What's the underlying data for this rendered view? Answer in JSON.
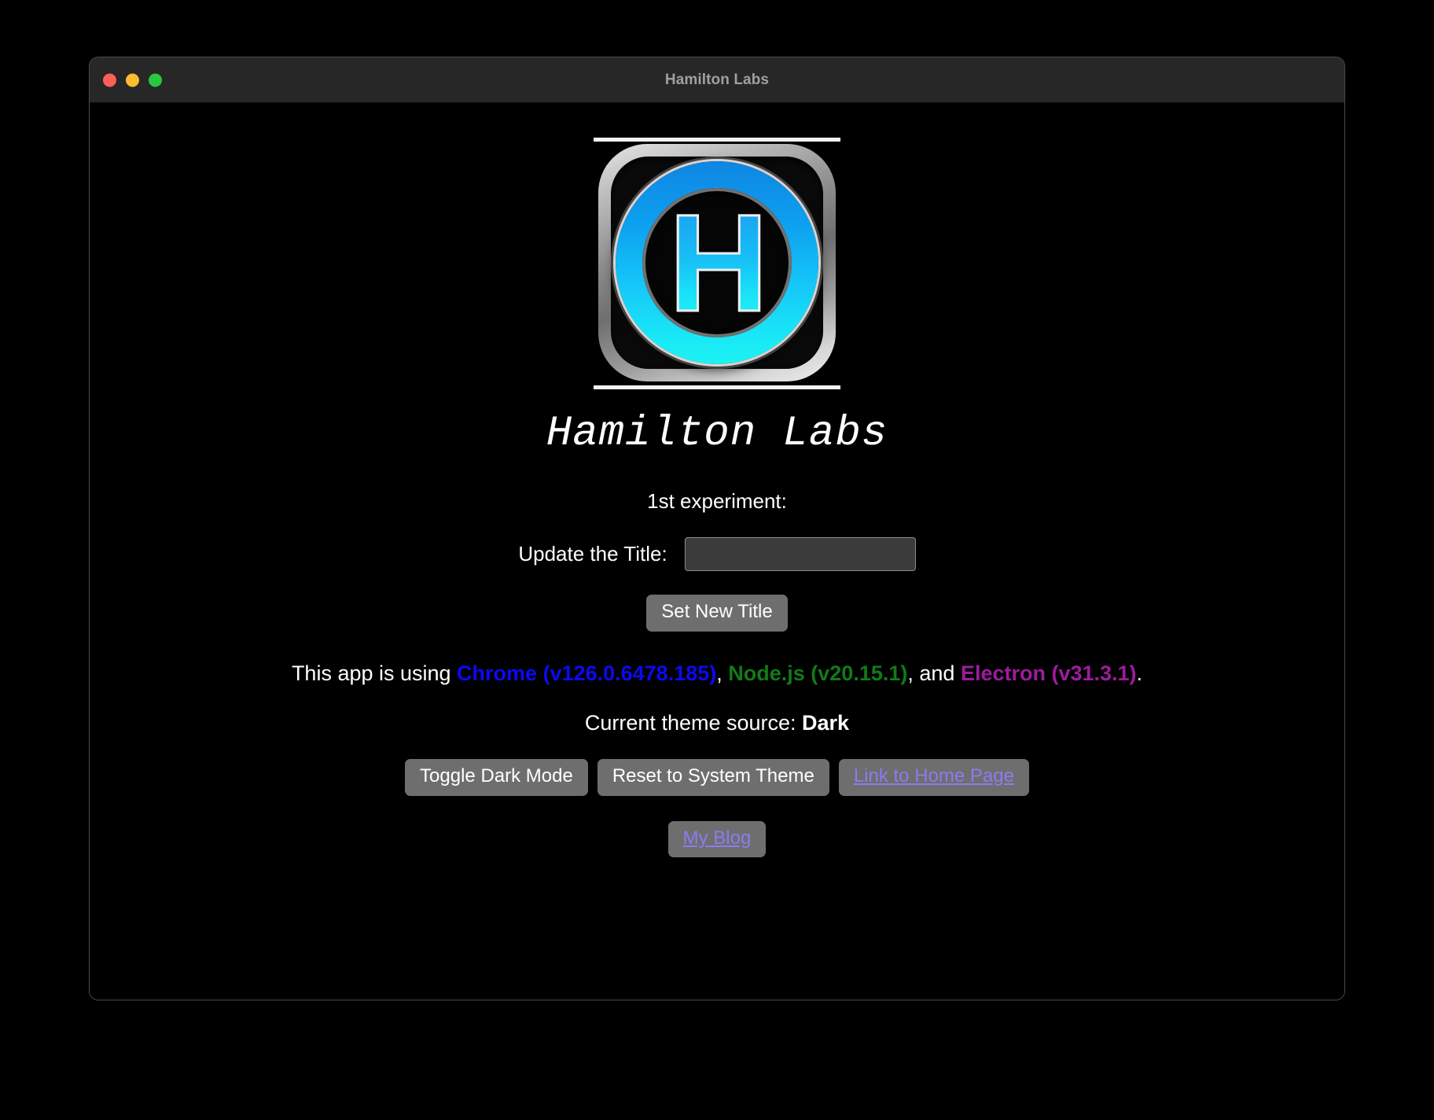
{
  "window": {
    "title": "Hamilton Labs",
    "traffic_lights": [
      {
        "name": "close",
        "color": "#ff5f57"
      },
      {
        "name": "minimize",
        "color": "#febc2e"
      },
      {
        "name": "maximize",
        "color": "#28c840"
      }
    ]
  },
  "logo": {
    "letter": "H",
    "alt": "Hamilton Labs logo"
  },
  "main": {
    "brand_title": "Hamilton Labs",
    "experiment_label": "1st experiment:",
    "title_field": {
      "label": "Update the Title:",
      "value": "",
      "placeholder": ""
    },
    "set_title_button": "Set New Title",
    "versions": {
      "prefix": "This app is using ",
      "chrome": "Chrome (v126.0.6478.185)",
      "sep1": ", ",
      "node": "Node.js (v20.15.1)",
      "sep2": ", and ",
      "electron": "Electron (v31.3.1)",
      "suffix": "."
    },
    "theme": {
      "label": "Current theme source: ",
      "value": "Dark"
    },
    "buttons": [
      {
        "label": "Toggle Dark Mode",
        "is_link": false
      },
      {
        "label": "Reset to System Theme",
        "is_link": false
      },
      {
        "label": "Link to Home Page",
        "is_link": true
      }
    ],
    "blog_button": {
      "label": "My Blog",
      "is_link": true
    }
  },
  "colors": {
    "chrome": "#0b09f4",
    "node": "#137a17",
    "electron": "#9d1b9d",
    "link": "#8a7cf0",
    "button_bg": "#6e6e6e",
    "titlebar_bg": "#272727",
    "page_bg": "#000000"
  }
}
